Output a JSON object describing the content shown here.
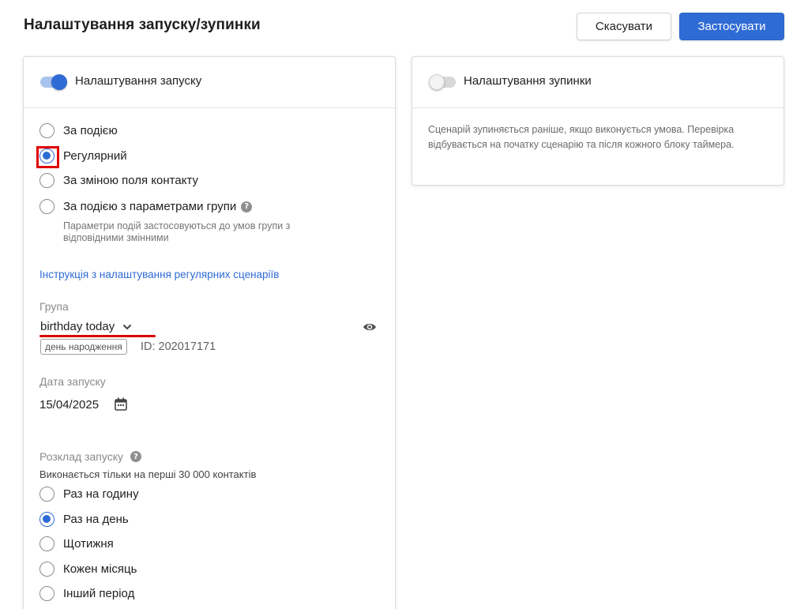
{
  "header": {
    "title": "Налаштування запуску/зупинки",
    "cancel_label": "Скасувати",
    "apply_label": "Застосувати"
  },
  "start_card": {
    "toggle_on": true,
    "title": "Налаштування запуску",
    "trigger_options": [
      {
        "label": "За подією",
        "checked": false
      },
      {
        "label": "Регулярний",
        "checked": true
      },
      {
        "label": "За зміною поля контакту",
        "checked": false
      },
      {
        "label": "За подією з параметрами групи",
        "checked": false
      }
    ],
    "group_params_hint": "Параметри подій застосовуються до умов групи з відповідними змінними",
    "instruction_link": "Інструкція з налаштування регулярних сценаріїв",
    "group": {
      "label": "Група",
      "value": "birthday today",
      "tag": "день народження",
      "id_text": "ID: 202017171"
    },
    "start_date": {
      "label": "Дата запуску",
      "value": "15/04/2025"
    },
    "schedule": {
      "label": "Розклад запуску",
      "note": "Виконається тільки на перші 30 000 контактів",
      "options": [
        {
          "label": "Раз на годину",
          "checked": false
        },
        {
          "label": "Раз на день",
          "checked": true
        },
        {
          "label": "Щотижня",
          "checked": false
        },
        {
          "label": "Кожен місяць",
          "checked": false
        },
        {
          "label": "Інший період",
          "checked": false
        }
      ]
    }
  },
  "stop_card": {
    "toggle_on": false,
    "title": "Налаштування зупинки",
    "description": "Сценарій зупиняється раніше, якщо виконується умова. Перевірка відбувається на початку сценарію та після кожного блоку таймера."
  },
  "icons": {
    "help": "question-circle-icon",
    "eye": "eye-icon",
    "calendar": "calendar-icon",
    "chevron": "chevron-down-icon"
  },
  "colors": {
    "accent": "#2f6bd4",
    "highlight": "#e00000"
  }
}
